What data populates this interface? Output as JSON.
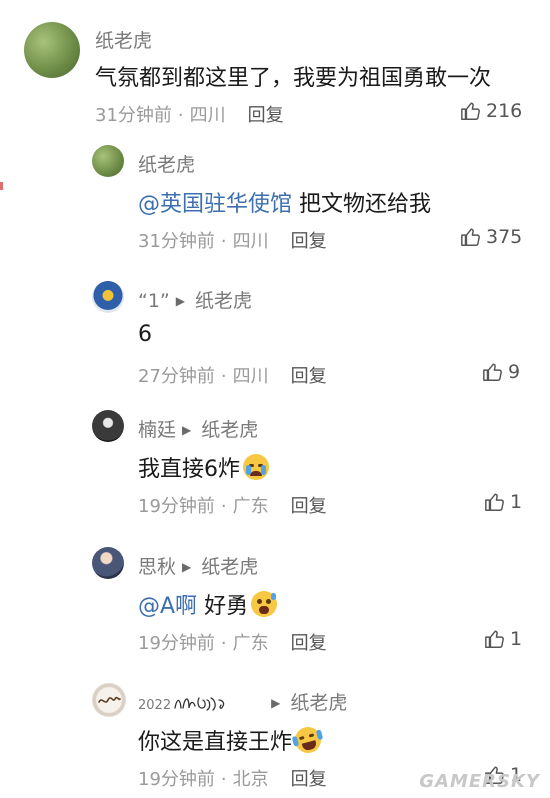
{
  "comments": [
    {
      "author": "纸老虎",
      "text": "气氛都到都这里了，我要为祖国勇敢一次",
      "time": "31分钟前",
      "location": "四川",
      "reply_label": "回复",
      "likes": "216"
    },
    {
      "author": "纸老虎",
      "mention": "@英国驻华使馆",
      "text": "把文物还给我",
      "time": "31分钟前",
      "location": "四川",
      "reply_label": "回复",
      "likes": "375"
    },
    {
      "author": "“1”",
      "reply_to": "纸老虎",
      "text": "6",
      "time": "27分钟前",
      "location": "四川",
      "reply_label": "回复",
      "likes": "9"
    },
    {
      "author": "楠廷",
      "reply_to": "纸老虎",
      "text": "我直接6炸",
      "emoji": "crying-face",
      "time": "19分钟前",
      "location": "广东",
      "reply_label": "回复",
      "likes": "1"
    },
    {
      "author": "思秋",
      "reply_to": "纸老虎",
      "mention": "@A啊",
      "text": "好勇",
      "emoji": "scared-face",
      "time": "19分钟前",
      "location": "广东",
      "reply_label": "回复",
      "likes": "1"
    },
    {
      "author": "2022",
      "reply_to": "纸老虎",
      "text": "你这是直接王炸",
      "emoji": "laughing-tears-face",
      "time": "19分钟前",
      "location": "北京",
      "reply_label": "回复",
      "likes": "1"
    }
  ],
  "separator": "·",
  "watermark": "GAMERSKY",
  "colors": {
    "mention": "#3d6fb0",
    "meta": "#9a9a9a",
    "name": "#7a7a7a"
  }
}
